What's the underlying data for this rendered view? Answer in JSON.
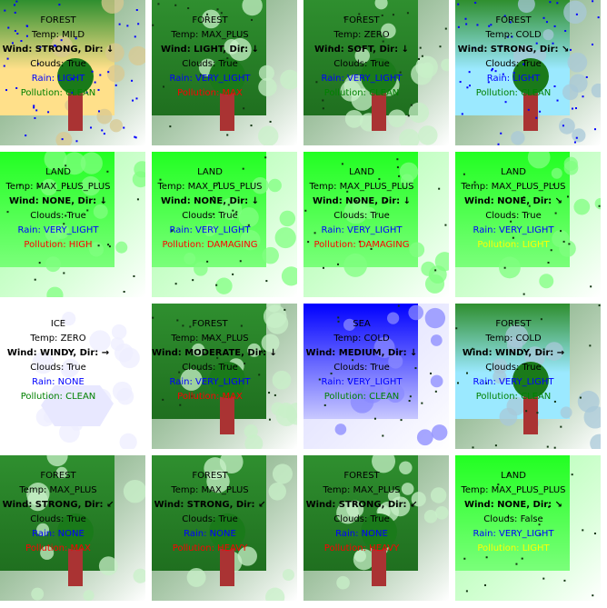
{
  "colors": {
    "rain_text": "#0000ff",
    "pollution": {
      "CLEAN": "#008000",
      "MAX": "#ff0000",
      "HIGH": "#ff0000",
      "DAMAGING": "#ff0000",
      "HEAVY": "#ff0000",
      "LIGHT": "#ffff00"
    },
    "biome": {
      "FOREST": [
        "#2f8f2f",
        "#1f6f1f"
      ],
      "LAND": [
        "#22ff22",
        "#7aff7a"
      ],
      "ICE": [
        "#ffffff",
        "#ffffff"
      ],
      "SEA": [
        "#0000ff",
        "#c8c8ff"
      ]
    },
    "tree_trunk": "#aa3333",
    "tree_crown": "#1a7a1a"
  },
  "tiles": [
    {
      "biome": "FOREST",
      "temp_label": "Temp: MILD",
      "wind_label": "Wind: STRONG, Dir: ↓",
      "clouds_label": "Clouds: True",
      "rain_label": "Rain: LIGHT",
      "pollution_label": "Pollution: CLEAN",
      "pollution": "CLEAN",
      "tint": "#ffe08a",
      "tree": true,
      "drops": "blue"
    },
    {
      "biome": "FOREST",
      "temp_label": "Temp: MAX_PLUS",
      "wind_label": "Wind: LIGHT, Dir: ↓",
      "clouds_label": "Clouds: True",
      "rain_label": "Rain: VERY_LIGHT",
      "pollution_label": "Pollution: MAX",
      "pollution": "MAX",
      "tint": "",
      "tree": true,
      "drops": "dark"
    },
    {
      "biome": "FOREST",
      "temp_label": "Temp: ZERO",
      "wind_label": "Wind: SOFT, Dir: ↓",
      "clouds_label": "Clouds: True",
      "rain_label": "Rain: VERY_LIGHT",
      "pollution_label": "Pollution: CLEAN",
      "pollution": "CLEAN",
      "tint": "",
      "tree": true,
      "drops": "dark"
    },
    {
      "biome": "FOREST",
      "temp_label": "Temp: COLD",
      "wind_label": "Wind: STRONG, Dir: ↘",
      "clouds_label": "Clouds: True",
      "rain_label": "Rain: LIGHT",
      "pollution_label": "Pollution: CLEAN",
      "pollution": "CLEAN",
      "tint": "#9be9ff",
      "tree": true,
      "drops": "blue"
    },
    {
      "biome": "LAND",
      "temp_label": "Temp: MAX_PLUS_PLUS",
      "wind_label": "Wind: NONE, Dir: ↓",
      "clouds_label": "Clouds: True",
      "rain_label": "Rain: VERY_LIGHT",
      "pollution_label": "Pollution: HIGH",
      "pollution": "HIGH",
      "tint": "",
      "tree": false,
      "drops": "dark"
    },
    {
      "biome": "LAND",
      "temp_label": "Temp: MAX_PLUS_PLUS",
      "wind_label": "Wind: NONE, Dir: ↓",
      "clouds_label": "Clouds: True",
      "rain_label": "Rain: VERY_LIGHT",
      "pollution_label": "Pollution: DAMAGING",
      "pollution": "DAMAGING",
      "tint": "",
      "tree": false,
      "drops": "dark"
    },
    {
      "biome": "LAND",
      "temp_label": "Temp: MAX_PLUS_PLUS",
      "wind_label": "Wind: NONE, Dir: ↓",
      "clouds_label": "Clouds: True",
      "rain_label": "Rain: VERY_LIGHT",
      "pollution_label": "Pollution: DAMAGING",
      "pollution": "DAMAGING",
      "tint": "",
      "tree": false,
      "drops": "dark"
    },
    {
      "biome": "LAND",
      "temp_label": "Temp: MAX_PLUS_PLUS",
      "wind_label": "Wind: NONE, Dir: ↘",
      "clouds_label": "Clouds: True",
      "rain_label": "Rain: VERY_LIGHT",
      "pollution_label": "Pollution: LIGHT",
      "pollution": "LIGHT",
      "tint": "",
      "tree": false,
      "drops": "dark"
    },
    {
      "biome": "ICE",
      "temp_label": "Temp: ZERO",
      "wind_label": "Wind: WINDY, Dir: →",
      "clouds_label": "Clouds: True",
      "rain_label": "Rain: NONE",
      "pollution_label": "Pollution: CLEAN",
      "pollution": "CLEAN",
      "tint": "",
      "tree": false,
      "drops": "none"
    },
    {
      "biome": "FOREST",
      "temp_label": "Temp: MAX_PLUS",
      "wind_label": "Wind: MODERATE, Dir: ↓",
      "clouds_label": "Clouds: True",
      "rain_label": "Rain: VERY_LIGHT",
      "pollution_label": "Pollution: MAX",
      "pollution": "MAX",
      "tint": "",
      "tree": true,
      "drops": "dark"
    },
    {
      "biome": "SEA",
      "temp_label": "Temp: COLD",
      "wind_label": "Wind: MEDIUM, Dir: ↓",
      "clouds_label": "Clouds: True",
      "rain_label": "Rain: VERY_LIGHT",
      "pollution_label": "Pollution: CLEAN",
      "pollution": "CLEAN",
      "tint": "",
      "tree": false,
      "drops": "dark"
    },
    {
      "biome": "FOREST",
      "temp_label": "Temp: COLD",
      "wind_label": "Wind: WINDY, Dir: →",
      "clouds_label": "Clouds: True",
      "rain_label": "Rain: VERY_LIGHT",
      "pollution_label": "Pollution: CLEAN",
      "pollution": "CLEAN",
      "tint": "#9be9ff",
      "tree": true,
      "drops": "dark"
    },
    {
      "biome": "FOREST",
      "temp_label": "Temp: MAX_PLUS",
      "wind_label": "Wind: STRONG, Dir: ↙",
      "clouds_label": "Clouds: True",
      "rain_label": "Rain: NONE",
      "pollution_label": "Pollution: MAX",
      "pollution": "MAX",
      "tint": "",
      "tree": true,
      "drops": "none"
    },
    {
      "biome": "FOREST",
      "temp_label": "Temp: MAX_PLUS",
      "wind_label": "Wind: STRONG, Dir: ↙",
      "clouds_label": "Clouds: True",
      "rain_label": "Rain: NONE",
      "pollution_label": "Pollution: HEAVY",
      "pollution": "HEAVY",
      "tint": "",
      "tree": true,
      "drops": "none"
    },
    {
      "biome": "FOREST",
      "temp_label": "Temp: MAX_PLUS",
      "wind_label": "Wind: STRONG, Dir: ↙",
      "clouds_label": "Clouds: True",
      "rain_label": "Rain: NONE",
      "pollution_label": "Pollution: HEAVY",
      "pollution": "HEAVY",
      "tint": "",
      "tree": true,
      "drops": "none"
    },
    {
      "biome": "LAND",
      "temp_label": "Temp: MAX_PLUS_PLUS",
      "wind_label": "Wind: NONE, Dir: ↘",
      "clouds_label": "Clouds: False",
      "rain_label": "Rain: VERY_LIGHT",
      "pollution_label": "Pollution: LIGHT",
      "pollution": "LIGHT",
      "tint": "",
      "tree": false,
      "drops": "dark"
    }
  ]
}
